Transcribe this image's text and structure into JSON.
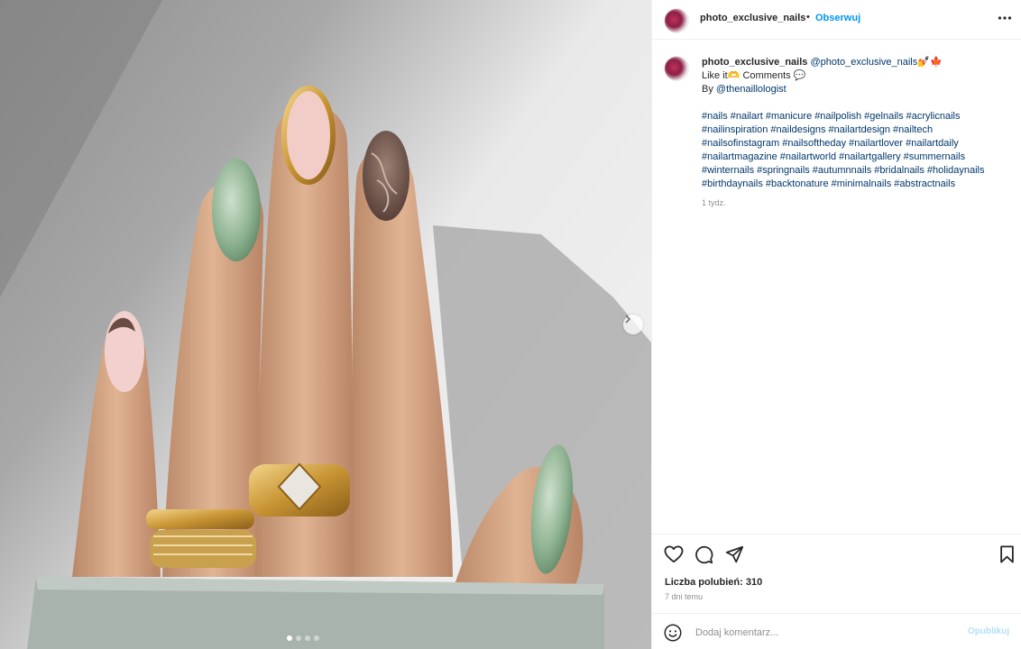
{
  "post": {
    "username": "photo_exclusive_nails",
    "separator": "•",
    "follow_label": "Obserwuj"
  },
  "caption": {
    "username": "photo_exclusive_nails",
    "mention": "@photo_exclusive_nails",
    "emojis": "💅🍁",
    "line2": "Like it🫶 Comments 💬",
    "by_prefix": "By ",
    "by_mention": "@thenaillologist",
    "hashtag_lines": [
      [
        "#nails",
        "#nailart",
        "#manicure",
        "#nailpolish",
        "#gelnails",
        "#acrylicnails"
      ],
      [
        "#nailinspiration",
        "#naildesigns",
        "#nailartdesign",
        "#nailtech"
      ],
      [
        "#nailsofinstagram",
        "#nailsoftheday",
        "#nailartlover",
        "#nailartdaily"
      ],
      [
        "#nailartmagazine",
        "#nailartworld",
        "#nailartgallery",
        "#summernails"
      ],
      [
        "#winternails",
        "#springnails",
        "#autumnnails",
        "#bridalnails",
        "#holidaynails"
      ],
      [
        "#birthdaynails",
        "#backtonature",
        "#minimalnails",
        "#abstractnails"
      ]
    ],
    "time": "1 tydz."
  },
  "engagement": {
    "likes": "Liczba polubień: 310",
    "ago": "7 dni temu"
  },
  "comment": {
    "placeholder": "Dodaj komentarz...",
    "post_label": "Opublikuj"
  },
  "icons": {
    "more": "more-icon",
    "like": "heart-icon",
    "comment": "comment-icon",
    "share": "share-icon",
    "save": "bookmark-icon",
    "emoji": "emoji-icon",
    "next": "chevron-right-icon"
  },
  "colors": {
    "follow": "#0095f6",
    "link": "#00376b",
    "post_disabled": "#b2dffc"
  },
  "carousel": {
    "slides": 4,
    "active_index": 0
  }
}
